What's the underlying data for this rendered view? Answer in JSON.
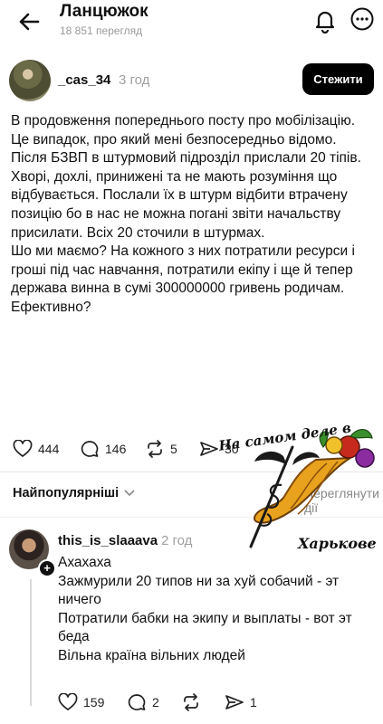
{
  "header": {
    "title": "Ланцюжок",
    "views": "18 851 перегляд"
  },
  "post": {
    "username": "_cas_34",
    "time": "3 год",
    "follow_label": "Стежити",
    "paragraphs": [
      "В продовження попереднього посту про мобілізацію.",
      "Це випадок, про який мені безпосередньо відомо.",
      "Після БЗВП в штурмовий підрозділ прислали 20 тіпів. Хворі, дохлі, принижені та не мають розуміння що відбувається. Послали їх в штурм відбити втрачену позицію бо в нас не можна погані звіти начальству присилати. Всіх 20 сточили в штурмах.",
      "Шо ми маємо? На кожного з них потратили ресурси і гроші під час навчання, потратили екіпу і ще й тепер держава винна в сумі 300000000 гривень родичам.",
      "Ефективно?"
    ],
    "likes": "444",
    "comments": "146",
    "reposts": "5",
    "shares": "30"
  },
  "sort": {
    "label": "Найпопулярніші",
    "activity_label": "Переглянути дії"
  },
  "reply": {
    "username": "this_is_slaaava",
    "time": "2 год",
    "more": "···",
    "paragraphs": [
      "Ахахаха",
      "Зажмурили 20 типов ни за хуй собачий - эт ничего",
      "Потратили бабки на экипу и выплаты - вот эт беда",
      "Вільна країна вільних людей"
    ],
    "likes": "159",
    "comments": "2",
    "shares": "1"
  },
  "sticker": {
    "line1": "На самом деле в",
    "line2": "Харькове"
  },
  "icons": {
    "back": "arrow-left-icon",
    "bell": "bell-icon",
    "more": "more-circle-icon",
    "like": "heart-icon",
    "comment": "comment-icon",
    "repost": "repost-icon",
    "share": "send-icon"
  }
}
